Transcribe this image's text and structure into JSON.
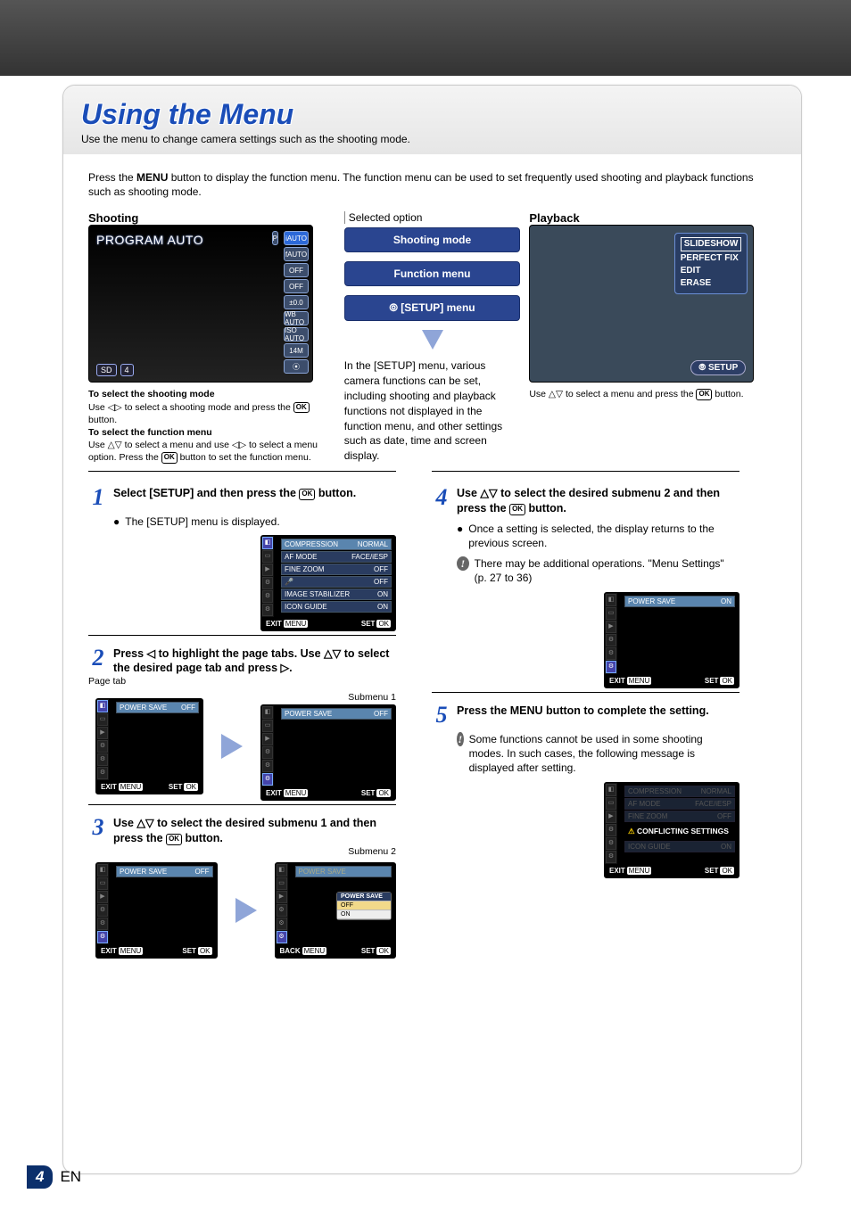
{
  "page": {
    "number": "4",
    "lang": "EN"
  },
  "title": "Using the Menu",
  "subtitle": "Use the menu to change camera settings such as the shooting mode.",
  "intro_a": "Press the ",
  "intro_menu": "MENU",
  "intro_b": " button to display the function menu. The function menu can be used to set frequently used shooting and playback functions such as shooting mode.",
  "labels": {
    "shooting": "Shooting",
    "playback": "Playback",
    "selected": "Selected option",
    "page_tab": "Page tab",
    "submenu1": "Submenu 1",
    "submenu2": "Submenu 2"
  },
  "shoot_screen": {
    "mode": "PROGRAM AUTO",
    "p": "P",
    "iauto": "iAUTO",
    "sd": "SD",
    "count": "4",
    "chips": [
      "iAUTO",
      "fAUTO",
      "OFF",
      "OFF",
      "±0.0",
      "WB AUTO",
      "ISO AUTO",
      "14M",
      "⦿"
    ]
  },
  "callouts": {
    "sm": "Shooting mode",
    "fm": "Function menu",
    "setup": "[SETUP] menu"
  },
  "playback": {
    "items": [
      "SLIDESHOW",
      "PERFECT FIX",
      "EDIT",
      "ERASE"
    ],
    "setup": "SETUP"
  },
  "notes": {
    "sel_shoot_h": "To select the shooting mode",
    "sel_shoot": "Use ◁▷ to select a shooting mode and press the ",
    "ok": "OK",
    "btn": " button.",
    "sel_func_h": "To select the function menu",
    "sel_func": "Use △▽ to select a menu and use ◁▷ to select a menu option. Press the ",
    "sel_func2": " button to set the function menu.",
    "pb": "Use △▽ to select a menu and press the ",
    "pb2": " button."
  },
  "para_setup": "In the [SETUP] menu, various camera functions can be set, including shooting and playback functions not displayed in the function menu, and other settings such as date, time and screen display.",
  "steps": {
    "1": {
      "t1": "Select [SETUP] and then press the ",
      "t2": " button.",
      "b": "The [SETUP] menu is displayed."
    },
    "2": {
      "t": "Press ◁ to highlight the page tabs. Use △▽ to select the desired page tab and press ▷."
    },
    "3": {
      "t1": "Use △▽ to select the desired submenu 1 and then press the ",
      "t2": " button."
    },
    "4": {
      "t1": "Use △▽ to select the desired submenu 2 and then press the ",
      "t2": " button.",
      "b": "Once a setting is selected, the display returns to the previous screen.",
      "note": "There may be additional operations. \"Menu Settings\" (p. 27 to 36)"
    },
    "5": {
      "t1": "Press the ",
      "menu": "MENU",
      "t2": " button to complete the setting.",
      "note": "Some functions cannot be used in some shooting modes. In such cases, the following message is displayed after setting."
    }
  },
  "menu1": {
    "rows": [
      [
        "COMPRESSION",
        "NORMAL"
      ],
      [
        "AF MODE",
        "FACE/iESP"
      ],
      [
        "FINE ZOOM",
        "OFF"
      ],
      [
        "🎤",
        "OFF"
      ],
      [
        "IMAGE STABILIZER",
        "ON"
      ],
      [
        "ICON GUIDE",
        "ON"
      ]
    ],
    "exit": "EXIT",
    "exitb": "MENU",
    "set": "SET",
    "setb": "OK"
  },
  "ps": {
    "label": "POWER SAVE",
    "off": "OFF",
    "on": "ON",
    "back": "BACK"
  },
  "popup": {
    "title": "POWER SAVE",
    "off": "OFF",
    "on": "ON"
  },
  "conflict": {
    "rows": [
      [
        "COMPRESSION",
        "NORMAL"
      ],
      [
        "AF MODE",
        "FACE/iESP"
      ],
      [
        "FINE ZOOM",
        "OFF"
      ],
      [
        "ICON GUIDE",
        "ON"
      ]
    ],
    "msg": "CONFLICTING SETTINGS"
  }
}
